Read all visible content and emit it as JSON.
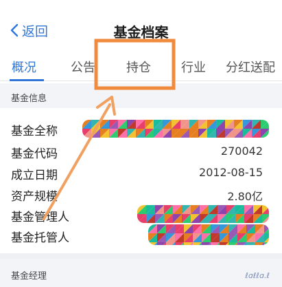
{
  "header": {
    "back_label": "返回",
    "title": "基金档案"
  },
  "tabs": [
    {
      "label": "概况",
      "active": true
    },
    {
      "label": "公告",
      "active": false
    },
    {
      "label": "持仓",
      "active": false
    },
    {
      "label": "行业",
      "active": false
    },
    {
      "label": "分红送配",
      "active": false
    }
  ],
  "fund_info": {
    "section_title": "基金信息",
    "rows": [
      {
        "label": "基金全称",
        "value": ""
      },
      {
        "label": "基金代码",
        "value": "270042"
      },
      {
        "label": "成立日期",
        "value": "2012-08-15"
      },
      {
        "label": "资产规模",
        "value": "2.80亿"
      },
      {
        "label": "基金管理人",
        "value": ""
      },
      {
        "label": "基金托管人",
        "value": ""
      }
    ]
  },
  "manager": {
    "section_title": "基金经理"
  },
  "colors": {
    "accent": "#2f76d8",
    "highlight": "#f08a3c"
  }
}
